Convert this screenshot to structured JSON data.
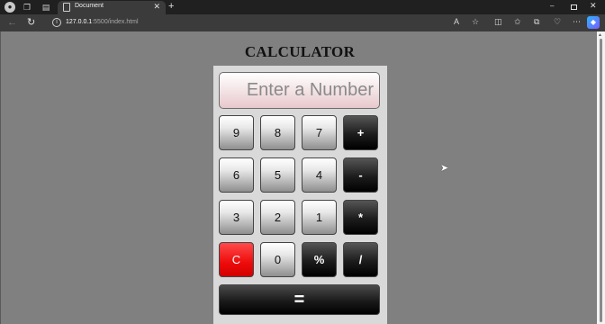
{
  "browser": {
    "tab_title": "Document",
    "tab_close": "✕",
    "new_tab": "+",
    "url_host": "127.0.0.1",
    "url_rest": ":5500/index.html",
    "window_min": "–",
    "window_close": "✕"
  },
  "page": {
    "heading": "CALCULATOR"
  },
  "calculator": {
    "display_placeholder": "Enter a Number",
    "rows": [
      [
        "9",
        "8",
        "7",
        "+"
      ],
      [
        "6",
        "5",
        "4",
        "-"
      ],
      [
        "3",
        "2",
        "1",
        "*"
      ],
      [
        "C",
        "0",
        "%",
        "/"
      ]
    ],
    "equals": "="
  },
  "colors": {
    "page_background": "#808080",
    "calculator_panel": "#d9d9d9",
    "clear_button": "#ee0b0b",
    "operator_button": "#1c1c1c"
  },
  "icons": {
    "profile": "profile-icon",
    "workspaces": "workspaces-icon",
    "tab_actions": "tab-actions-icon",
    "back": "back-arrow-icon",
    "refresh": "refresh-icon",
    "site_info": "info-icon",
    "read_aloud": "read-aloud-icon",
    "favorite": "star-icon",
    "split_screen": "split-screen-icon",
    "favorites": "favorites-icon",
    "collections": "collections-icon",
    "browser_essentials": "heart-icon",
    "more": "more-icon",
    "copilot": "copilot-icon"
  }
}
